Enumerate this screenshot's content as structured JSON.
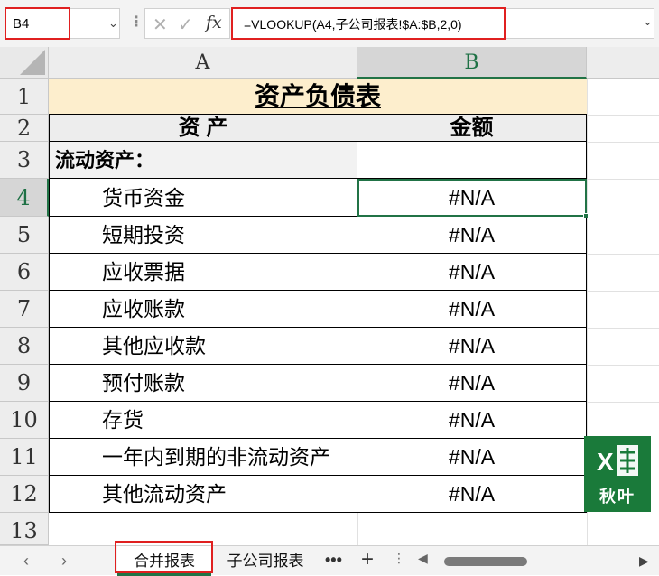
{
  "formula_bar": {
    "name_box": "B4",
    "formula": "=VLOOKUP(A4,子公司报表!$A:$B,2,0)",
    "cancel_glyph": "✕",
    "enter_glyph": "✓",
    "fx_label": "fx"
  },
  "columns": [
    "A",
    "B"
  ],
  "rows": [
    "1",
    "2",
    "3",
    "4",
    "5",
    "6",
    "7",
    "8",
    "9",
    "10",
    "11",
    "12",
    "13"
  ],
  "sheet": {
    "title": "资产负债表",
    "header_asset": "资                    产",
    "header_amount": "金额",
    "section": "流动资产：",
    "items": [
      {
        "name": "货币资金",
        "value": "#N/A"
      },
      {
        "name": "短期投资",
        "value": "#N/A"
      },
      {
        "name": "应收票据",
        "value": "#N/A"
      },
      {
        "name": "应收账款",
        "value": "#N/A"
      },
      {
        "name": "其他应收款",
        "value": "#N/A"
      },
      {
        "name": "预付账款",
        "value": "#N/A"
      },
      {
        "name": "存货",
        "value": "#N/A"
      },
      {
        "name": "一年内到期的非流动资产",
        "value": "#N/A"
      },
      {
        "name": "其他流动资产",
        "value": "#N/A"
      }
    ]
  },
  "logo": {
    "text": "秋叶",
    "mark": "X"
  },
  "tabs": {
    "items": [
      "合并报表",
      "子公司报表"
    ],
    "active": "合并报表",
    "more": "•••",
    "add": "+"
  },
  "colors": {
    "accent": "#217346",
    "highlight": "#e02020",
    "title_fill": "#fdeecd"
  }
}
